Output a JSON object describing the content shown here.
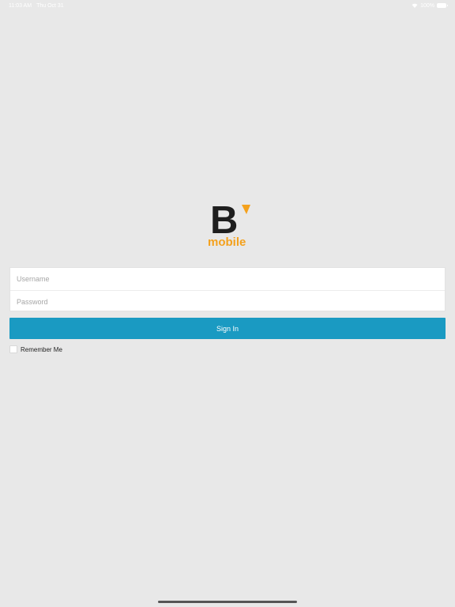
{
  "status_bar": {
    "time": "11:03 AM",
    "date": "Thu Oct 31",
    "battery": "100%",
    "wifi_icon": "wifi-icon",
    "battery_icon": "battery-icon"
  },
  "logo": {
    "letter": "B",
    "wordmark": "mobile",
    "colors": {
      "letter": "#1e1e1e",
      "accent": "#f4a11d"
    }
  },
  "login": {
    "username_placeholder": "Username",
    "password_placeholder": "Password",
    "sign_in_label": "Sign In",
    "remember_me_label": "Remember Me",
    "remember_me_checked": false
  },
  "colors": {
    "background": "#e8e8e8",
    "primary_button": "#1a9ac2"
  }
}
